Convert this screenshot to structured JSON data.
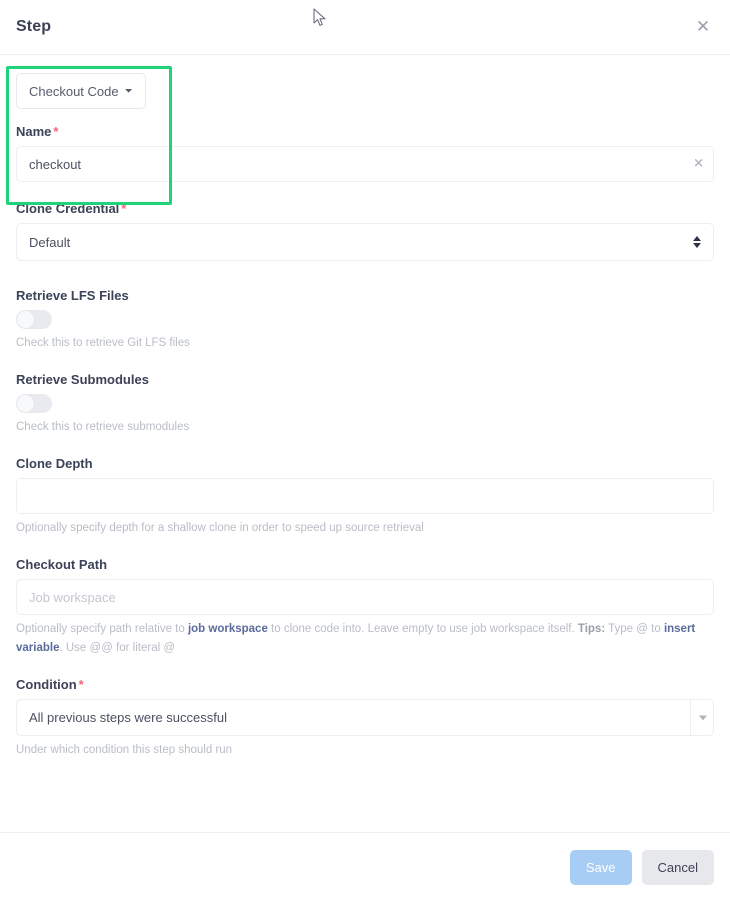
{
  "header": {
    "title": "Step",
    "close_icon": "close-icon"
  },
  "step_type": {
    "label": "Checkout Code",
    "chevron_icon": "chevron-down-icon"
  },
  "fields": {
    "name": {
      "label": "Name",
      "required_marker": "*",
      "value": "checkout",
      "placeholder": "",
      "clear_icon": "close-icon"
    },
    "clone_credential": {
      "label": "Clone Credential",
      "required_marker": "*",
      "value": "Default",
      "options": [
        "Default"
      ]
    },
    "retrieve_lfs": {
      "label": "Retrieve LFS Files",
      "state": "off",
      "help": "Check this to retrieve Git LFS files"
    },
    "retrieve_submodules": {
      "label": "Retrieve Submodules",
      "state": "off",
      "help": "Check this to retrieve submodules"
    },
    "clone_depth": {
      "label": "Clone Depth",
      "value": "",
      "placeholder": "",
      "help": "Optionally specify depth for a shallow clone in order to speed up source retrieval"
    },
    "checkout_path": {
      "label": "Checkout Path",
      "value": "",
      "placeholder": "Job workspace",
      "help_part1": "Optionally specify path relative to ",
      "help_link1": "job workspace",
      "help_part2": " to clone code into. Leave empty to use job workspace itself. ",
      "help_tips_label": "Tips:",
      "help_part3": " Type @ to ",
      "help_link2": "insert variable",
      "help_part4": ". Use @@ for literal @"
    },
    "condition": {
      "label": "Condition",
      "required_marker": "*",
      "value": "All previous steps were successful",
      "caret_icon": "caret-down-icon",
      "help": "Under which condition this step should run"
    }
  },
  "footer": {
    "save_label": "Save",
    "cancel_label": "Cancel"
  },
  "colors": {
    "highlight": "#1fd37a",
    "required": "#f2647d",
    "primary_button": "#a8cdf5",
    "secondary_button": "#e7e8eb",
    "link": "#5b6b9c",
    "label_text": "#3c4257",
    "help_text": "#b9bdc6"
  }
}
